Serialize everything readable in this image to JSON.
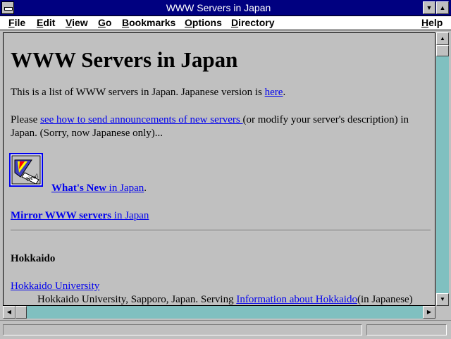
{
  "window": {
    "title": "WWW Servers in Japan"
  },
  "menu": {
    "file": {
      "mnemonic": "F",
      "rest": "ile"
    },
    "edit": {
      "mnemonic": "E",
      "rest": "dit"
    },
    "view": {
      "mnemonic": "V",
      "rest": "iew"
    },
    "go": {
      "mnemonic": "G",
      "rest": "o"
    },
    "bookmarks": {
      "mnemonic": "B",
      "rest": "ookmarks"
    },
    "options": {
      "mnemonic": "O",
      "rest": "ptions"
    },
    "directory": {
      "mnemonic": "D",
      "rest": "irectory"
    },
    "help": {
      "mnemonic": "H",
      "rest": "elp"
    }
  },
  "page": {
    "heading": "WWW Servers in Japan",
    "intro_text": "This is a list of WWW servers in Japan. Japanese version is ",
    "intro_link": "here",
    "intro_end": ".",
    "please_text": "Please ",
    "please_link": "see how to send announcements of new servers ",
    "please_rest": "(or modify your server's description) in",
    "please_line2": "Japan. (Sorry, now Japanese only)...",
    "new_icon_label": "New!",
    "whats_new_link": "What's New",
    "whats_new_suffix_link": " in Japan",
    "whats_new_end": ".",
    "mirror_link": "Mirror WWW servers",
    "mirror_suffix_link": " in Japan",
    "section_heading": "Hokkaido",
    "entry_link": "Hokkaido University",
    "entry_desc": "Hokkaido University, Sapporo, Japan. Serving ",
    "entry_desc_link": "Information about Hokkaido",
    "entry_desc_end": "(in Japanese)"
  },
  "colors": {
    "titlebar": "#000080",
    "link": "#0000ee",
    "background": "#c0c0c0",
    "scroll_track": "#80c0c0"
  }
}
